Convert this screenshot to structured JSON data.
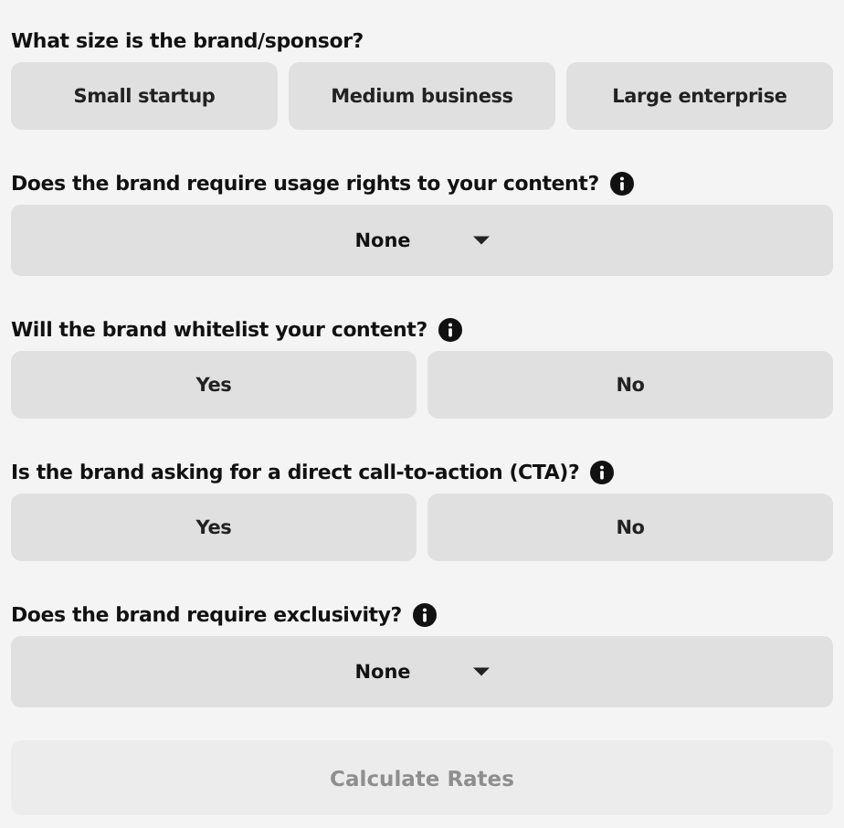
{
  "questions": [
    {
      "kind": "options",
      "label": "What size is the brand/sponsor?",
      "info": false,
      "options": [
        {
          "label": "Small startup",
          "selected": false
        },
        {
          "label": "Medium business",
          "selected": false
        },
        {
          "label": "Large enterprise",
          "selected": false
        }
      ]
    },
    {
      "kind": "select",
      "label": "Does the brand require usage rights to your content?",
      "info": true,
      "value": "None"
    },
    {
      "kind": "options",
      "label": "Will the brand whitelist your content?",
      "info": true,
      "options": [
        {
          "label": "Yes",
          "selected": false
        },
        {
          "label": "No",
          "selected": false
        }
      ]
    },
    {
      "kind": "options",
      "label": "Is the brand asking for a direct call-to-action (CTA)?",
      "info": true,
      "options": [
        {
          "label": "Yes",
          "selected": false
        },
        {
          "label": "No",
          "selected": false
        }
      ]
    },
    {
      "kind": "select",
      "label": "Does the brand require exclusivity?",
      "info": true,
      "value": "None"
    }
  ],
  "submit": {
    "label": "Calculate Rates",
    "disabled": true
  }
}
